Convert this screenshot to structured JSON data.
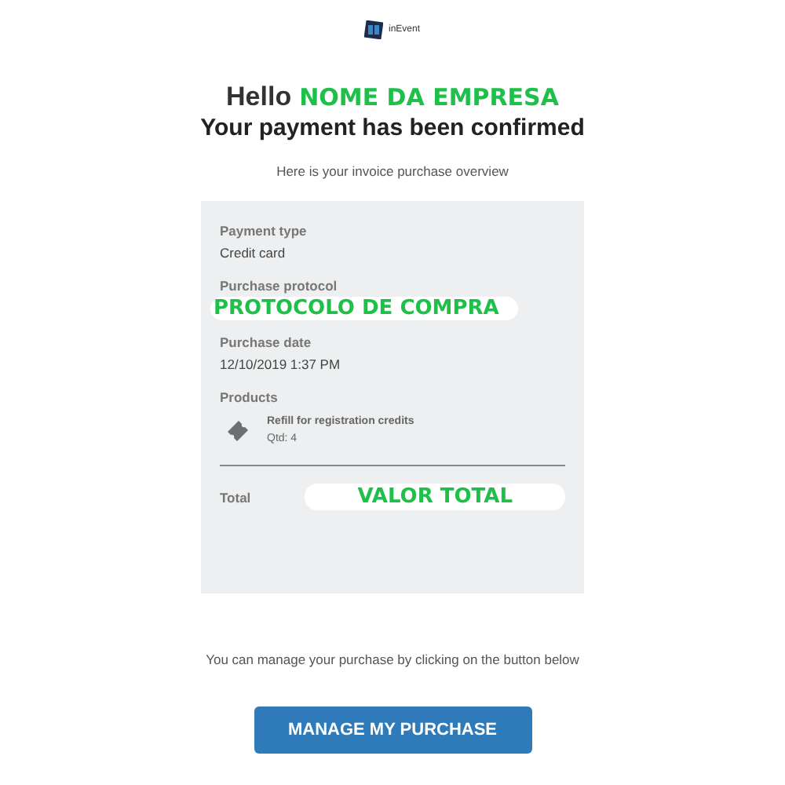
{
  "logo": {
    "text": "inEvent"
  },
  "greeting": {
    "prefix": "Hello",
    "name": "NOME DA EMPRESA"
  },
  "heading": "Your payment has been confirmed",
  "intro": "Here is your invoice purchase overview",
  "invoice": {
    "fields": [
      {
        "label": "Payment type",
        "value": "Credit card",
        "kind": "plain"
      },
      {
        "label": "Purchase protocol",
        "value": "PROTOCOLO DE COMPRA",
        "kind": "highlight"
      },
      {
        "label": "Purchase date",
        "value": "12/10/2019 1:37 PM",
        "kind": "plain"
      }
    ],
    "products_label": "Products",
    "products": [
      {
        "name": "Refill for registration credits",
        "quantity": "Qtd: 4"
      }
    ],
    "total_label": "Total",
    "total_value": "VALOR TOTAL"
  },
  "note": "You can manage your purchase by clicking on the button below",
  "button": "MANAGE MY PURCHASE"
}
